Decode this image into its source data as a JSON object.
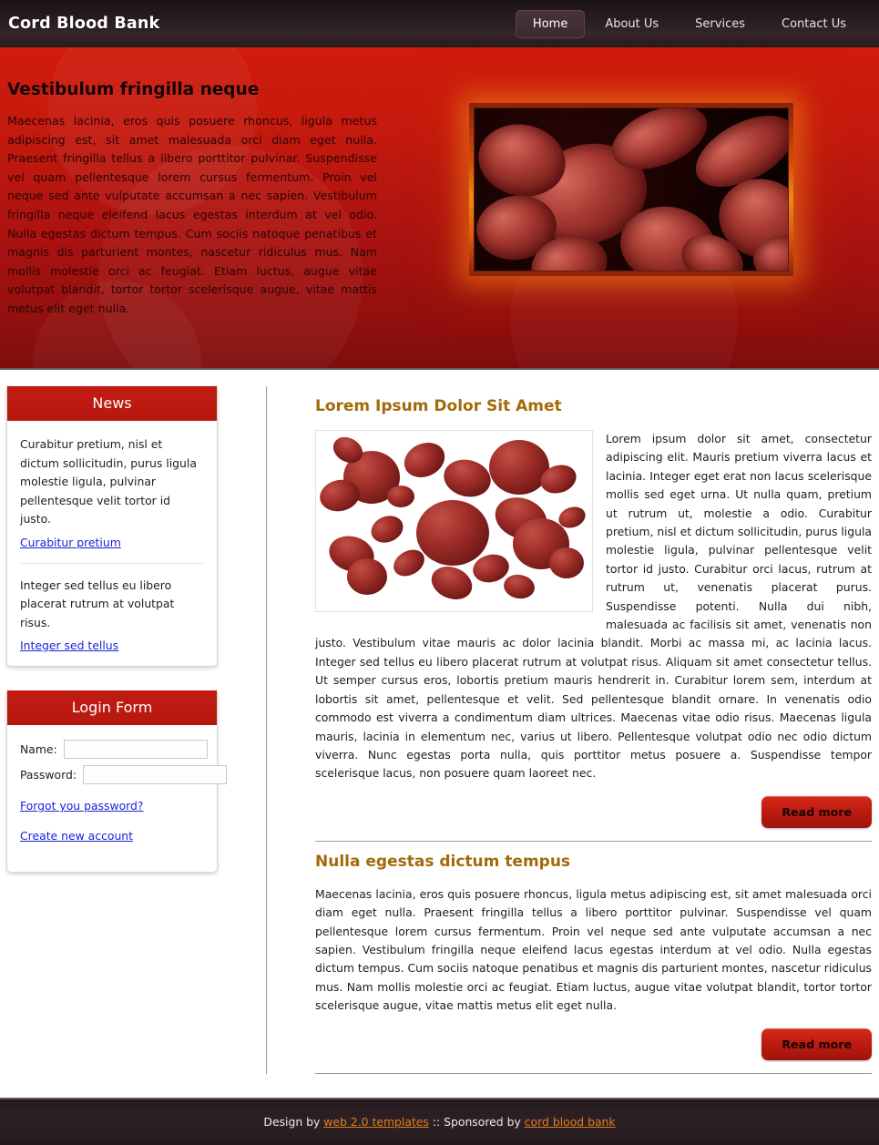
{
  "header": {
    "logo": "Cord Blood Bank",
    "nav": [
      {
        "label": "Home",
        "active": true
      },
      {
        "label": "About Us",
        "active": false
      },
      {
        "label": "Services",
        "active": false
      },
      {
        "label": "Contact Us",
        "active": false
      }
    ]
  },
  "hero": {
    "title": "Vestibulum fringilla neque",
    "text": "Maecenas lacinia, eros quis posuere rhoncus, ligula metus adipiscing est, sit amet malesuada orci diam eget nulla. Praesent fringilla tellus a libero porttitor pulvinar. Suspendisse vel quam pellentesque lorem cursus fermentum. Proin vel neque sed ante vulputate accumsan a nec sapien. Vestibulum fringilla neque eleifend lacus egestas interdum at vel odio. Nulla egestas dictum tempus. Cum sociis natoque penatibus et magnis dis parturient montes, nascetur ridiculus mus. Nam mollis molestie orci ac feugiat. Etiam luctus, augue vitae volutpat blandit, tortor tortor scelerisque augue, vitae mattis metus elit eget nulla.",
    "image_alt": "red-blood-cells-microscopy"
  },
  "sidebar": {
    "news": {
      "title": "News",
      "items": [
        {
          "text": "Curabitur pretium, nisl et dictum sollicitudin, purus ligula molestie ligula, pulvinar pellentesque velit tortor id justo.",
          "link": "Curabitur pretium"
        },
        {
          "text": "Integer sed tellus eu libero placerat rutrum at volutpat risus.",
          "link": "Integer sed tellus"
        }
      ]
    },
    "login": {
      "title": "Login Form",
      "name_label": "Name:",
      "name_value": "",
      "password_label": "Password:",
      "password_value": "",
      "forgot_link": "Forgot you password?",
      "create_link": "Create new account"
    }
  },
  "content": {
    "articles": [
      {
        "title": "Lorem Ipsum Dolor Sit Amet",
        "image_alt": "red-blood-cells-floating",
        "body": "Lorem ipsum dolor sit amet, consectetur adipiscing elit. Mauris pretium viverra lacus et lacinia. Integer eget erat non lacus scelerisque mollis sed eget urna. Ut nulla quam, pretium ut rutrum ut, molestie a odio. Curabitur pretium, nisl et dictum sollicitudin, purus ligula molestie ligula, pulvinar pellentesque velit tortor id justo. Curabitur orci lacus, rutrum at rutrum ut, venenatis placerat purus. Suspendisse potenti. Nulla dui nibh, malesuada ac facilisis sit amet, venenatis non justo. Vestibulum vitae mauris ac dolor lacinia blandit. Morbi ac massa mi, ac lacinia lacus. Integer sed tellus eu libero placerat rutrum at volutpat risus. Aliquam sit amet consectetur tellus. Ut semper cursus eros, lobortis pretium mauris hendrerit in. Curabitur lorem sem, interdum at lobortis sit amet, pellentesque et velit. Sed pellentesque blandit ornare. In venenatis odio commodo est viverra a condimentum diam ultrices. Maecenas vitae odio risus. Maecenas ligula mauris, lacinia in elementum nec, varius ut libero. Pellentesque volutpat odio nec odio dictum viverra. Nunc egestas porta nulla, quis porttitor metus posuere a. Suspendisse tempor scelerisque lacus, non posuere quam laoreet nec.",
        "read_more": "Read more"
      },
      {
        "title": "Nulla egestas dictum tempus",
        "body": "Maecenas lacinia, eros quis posuere rhoncus, ligula metus adipiscing est, sit amet malesuada orci diam eget nulla. Praesent fringilla tellus a libero porttitor pulvinar. Suspendisse vel quam pellentesque lorem cursus fermentum. Proin vel neque sed ante vulputate accumsan a nec sapien. Vestibulum fringilla neque eleifend lacus egestas interdum at vel odio. Nulla egestas dictum tempus. Cum sociis natoque penatibus et magnis dis parturient montes, nascetur ridiculus mus. Nam mollis molestie orci ac feugiat. Etiam luctus, augue vitae volutpat blandit, tortor tortor scelerisque augue, vitae mattis metus elit eget nulla.",
        "read_more": "Read more"
      }
    ]
  },
  "footer": {
    "design_by": "Design by",
    "design_link": "web 2.0 templates",
    "separator": "::",
    "sponsored_by": "Sponsored by",
    "sponsor_link": "cord blood bank"
  },
  "colors": {
    "brand_red": "#bd1a11",
    "hero_red": "#c61a0e",
    "heading_gold": "#a4690a",
    "link_blue": "#1a22d8",
    "footer_link_orange": "#e07b1e",
    "header_dark": "#2a1d21"
  }
}
